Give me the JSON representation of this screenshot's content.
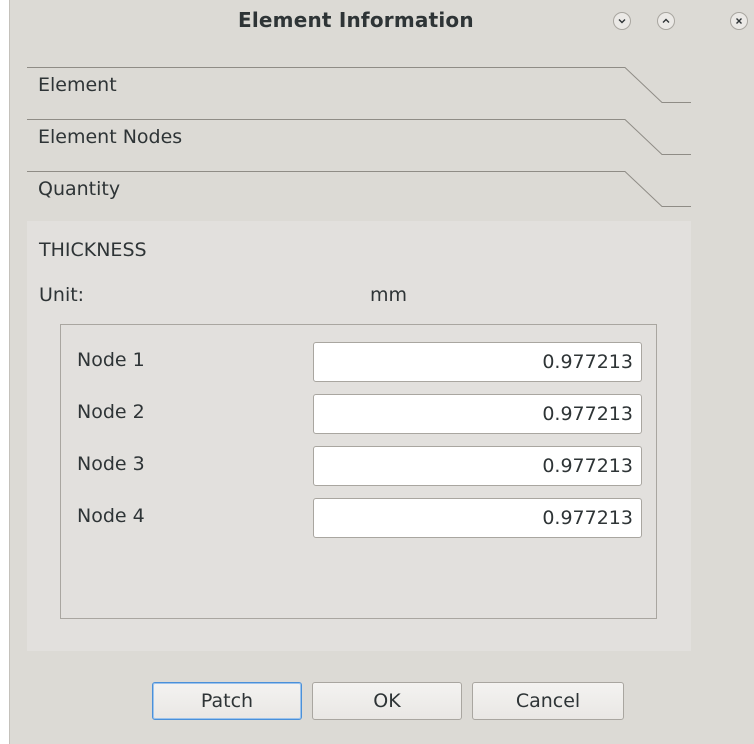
{
  "window": {
    "title": "Element Information",
    "controls": [
      "minimize-icon",
      "maximize-icon",
      "close-icon"
    ]
  },
  "sections": [
    {
      "label": "Element"
    },
    {
      "label": "Element Nodes"
    },
    {
      "label": "Quantity"
    }
  ],
  "quantity": {
    "name": "THICKNESS",
    "unit_label": "Unit:",
    "unit_value": "mm",
    "nodes": [
      {
        "label": "Node 1",
        "value": "0.977213"
      },
      {
        "label": "Node 2",
        "value": "0.977213"
      },
      {
        "label": "Node 3",
        "value": "0.977213"
      },
      {
        "label": "Node 4",
        "value": "0.977213"
      }
    ]
  },
  "buttons": {
    "patch": "Patch",
    "ok": "OK",
    "cancel": "Cancel"
  },
  "colors": {
    "window_bg": "#dcdad5",
    "panel_bg": "#e2e0dd",
    "text": "#2e3436",
    "focus": "#4a90d9"
  }
}
